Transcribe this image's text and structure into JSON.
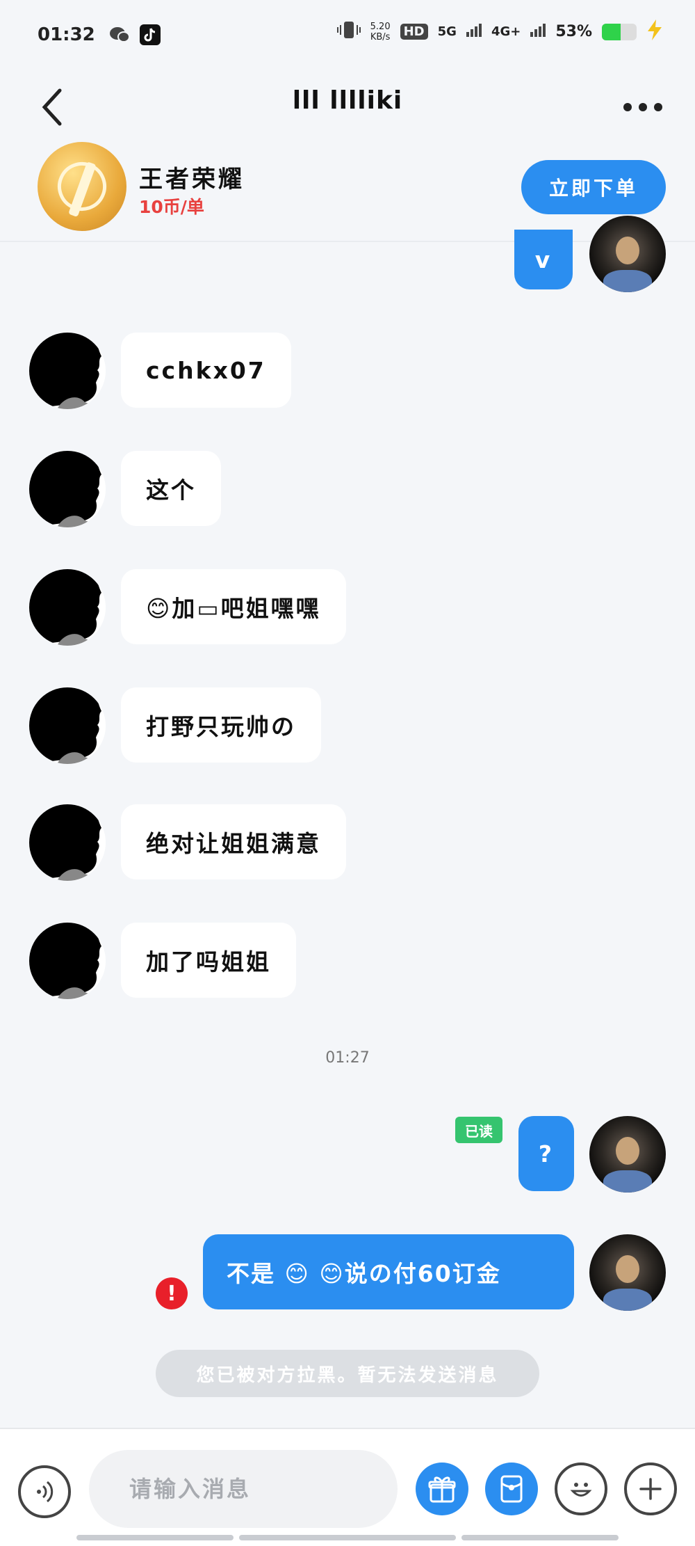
{
  "status_bar": {
    "time": "01:32",
    "net_speed_value": "5.20",
    "net_speed_unit": "KB/s",
    "hd_label": "HD",
    "network_5g": "5G",
    "network_4g": "4G+",
    "battery_percent": "53%",
    "battery_level": 0.53
  },
  "nav": {
    "title": "lll lllliki"
  },
  "game": {
    "name": "王者荣耀",
    "price": "10币/单",
    "order_button": "立即下单"
  },
  "messages": [
    {
      "side": "out",
      "text": "v"
    },
    {
      "side": "in",
      "text": "cchkx07"
    },
    {
      "side": "in",
      "text": "这个"
    },
    {
      "side": "in",
      "text": "😊加▭吧姐嘿嘿"
    },
    {
      "side": "in",
      "text": "打野只玩帅の"
    },
    {
      "side": "in",
      "text": "绝对让姐姐满意"
    },
    {
      "side": "in",
      "text": "加了吗姐姐"
    },
    {
      "side": "out",
      "text": "?"
    },
    {
      "side": "out",
      "text": "不是 😊 😊说の付60订金"
    }
  ],
  "timestamp": "01:27",
  "read_badge": "已读",
  "error_mark": "!",
  "blocked_notice": "您已被对方拉黑。暂无法发送消息",
  "input": {
    "placeholder": "请输入消息"
  },
  "colors": {
    "accent_blue": "#2b8ef0",
    "price_red": "#e8413f",
    "read_green": "#35c46f",
    "error_red": "#e8202a"
  },
  "icons": {
    "back": "chevron-left-icon",
    "more": "more-dots-icon",
    "voice": "voice-icon",
    "gift": "gift-icon",
    "red_packet": "red-packet-icon",
    "emoji": "emoji-icon",
    "plus": "plus-icon"
  }
}
